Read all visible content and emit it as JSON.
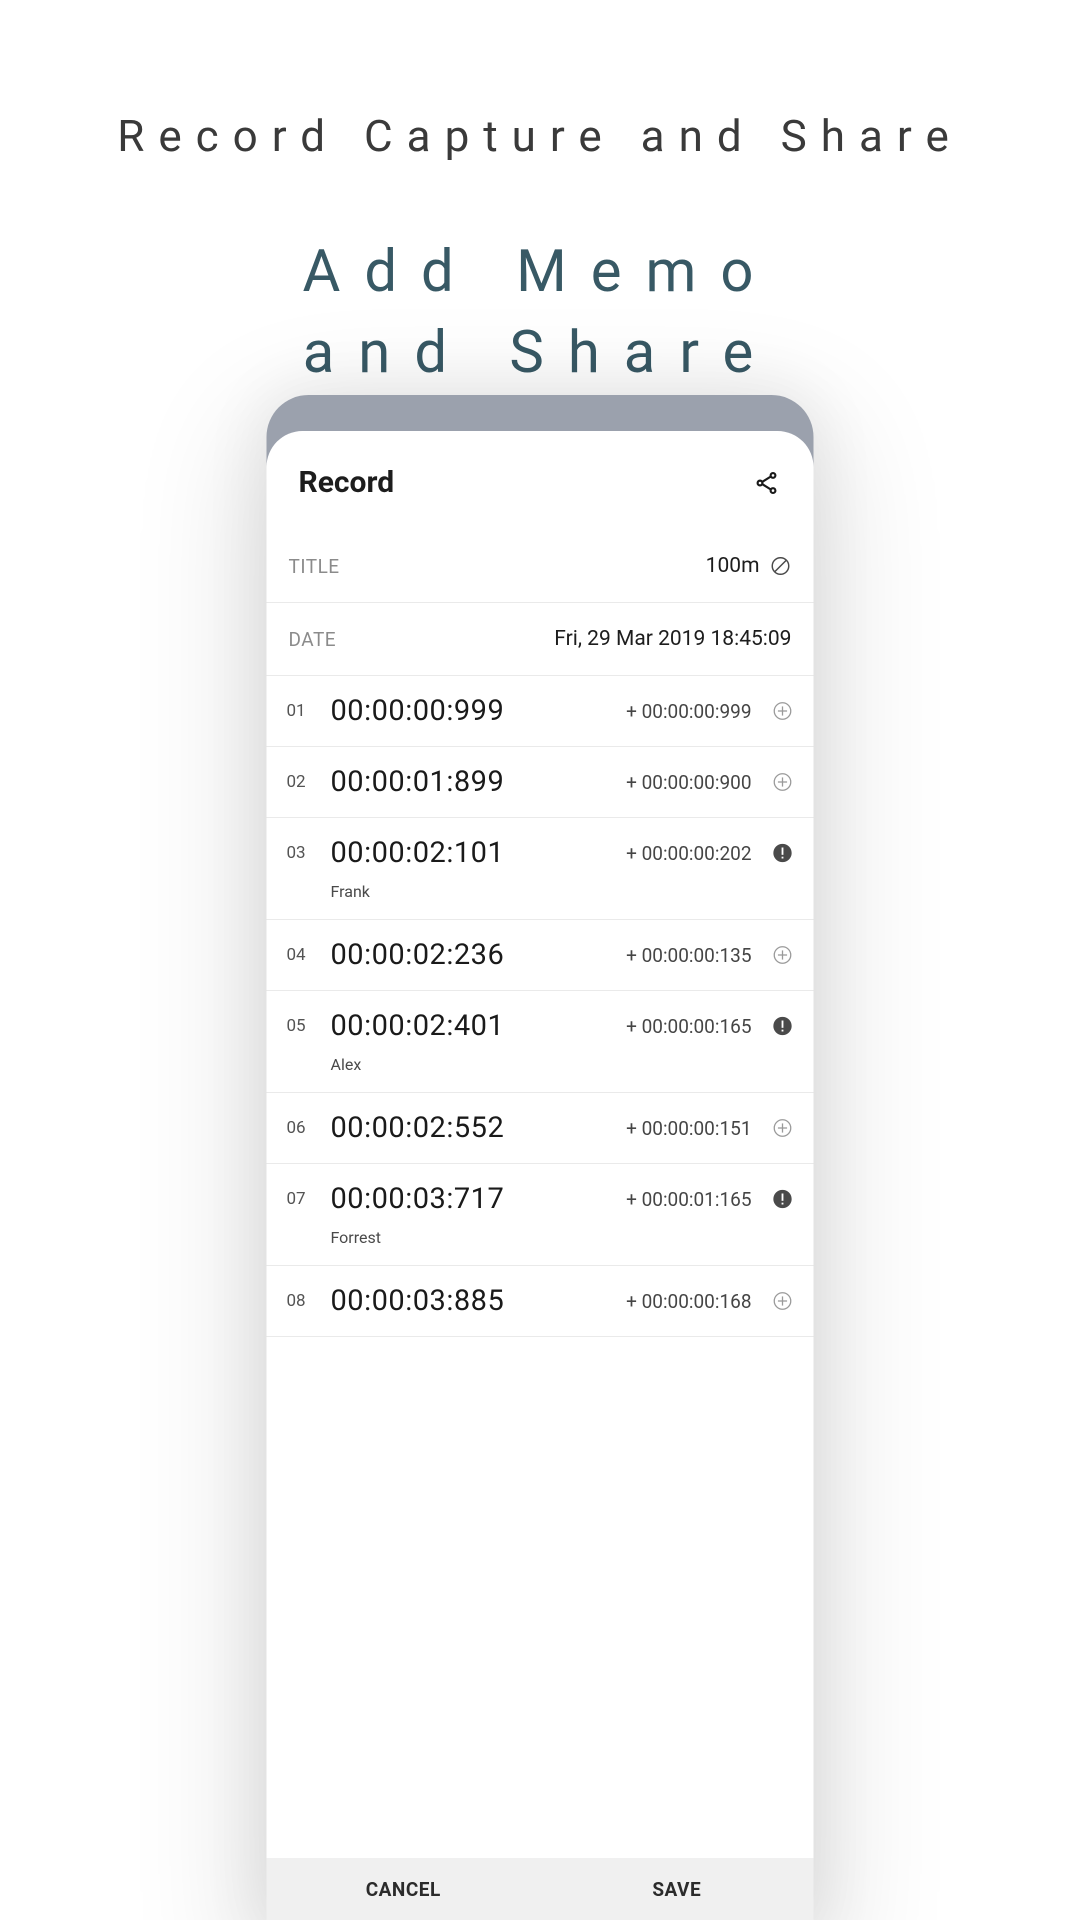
{
  "marketing": {
    "title": "Record Capture and Share",
    "subtitle_line1": "Add Memo",
    "subtitle_line2": "and Share"
  },
  "sheet": {
    "header": "Record",
    "title_label": "TITLE",
    "title_value": "100m",
    "date_label": "DATE",
    "date_value": "Fri, 29 Mar 2019 18:45:09",
    "laps": [
      {
        "num": "01",
        "time": "00:00:00:999",
        "split": "+ 00:00:00:999",
        "memo": "",
        "icon": "plus"
      },
      {
        "num": "02",
        "time": "00:00:01:899",
        "split": "+ 00:00:00:900",
        "memo": "",
        "icon": "plus"
      },
      {
        "num": "03",
        "time": "00:00:02:101",
        "split": "+ 00:00:00:202",
        "memo": "Frank",
        "icon": "alert"
      },
      {
        "num": "04",
        "time": "00:00:02:236",
        "split": "+ 00:00:00:135",
        "memo": "",
        "icon": "plus"
      },
      {
        "num": "05",
        "time": "00:00:02:401",
        "split": "+ 00:00:00:165",
        "memo": "Alex",
        "icon": "alert"
      },
      {
        "num": "06",
        "time": "00:00:02:552",
        "split": "+ 00:00:00:151",
        "memo": "",
        "icon": "plus"
      },
      {
        "num": "07",
        "time": "00:00:03:717",
        "split": "+ 00:00:01:165",
        "memo": "Forrest",
        "icon": "alert"
      },
      {
        "num": "08",
        "time": "00:00:03:885",
        "split": "+ 00:00:00:168",
        "memo": "",
        "icon": "plus"
      }
    ],
    "cancel": "CANCEL",
    "save": "SAVE"
  }
}
